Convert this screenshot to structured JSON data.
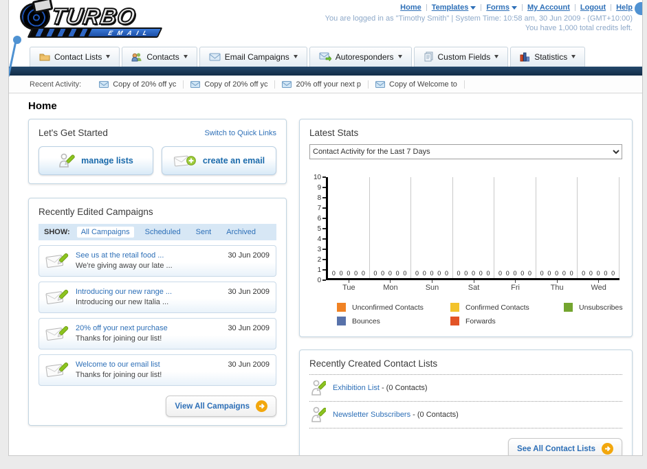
{
  "header": {
    "logo_title": "TURBO",
    "logo_subtitle": "EMAIL",
    "nav_links": [
      {
        "label": "Home",
        "dropdown": false
      },
      {
        "label": "Templates",
        "dropdown": true
      },
      {
        "label": "Forms",
        "dropdown": true
      },
      {
        "label": "My Account",
        "dropdown": false
      },
      {
        "label": "Logout",
        "dropdown": false
      },
      {
        "label": "Help",
        "dropdown": false
      }
    ],
    "login_info": "You are logged in as \"Timothy Smith\" | System Time: 10:58 am, 30 Jun 2009 - (GMT+10:00)",
    "credits_info": "You have 1,000 total credits left."
  },
  "nav_tabs": [
    {
      "label": "Contact Lists",
      "icon": "folder-icon"
    },
    {
      "label": "Contacts",
      "icon": "contacts-icon"
    },
    {
      "label": "Email Campaigns",
      "icon": "envelope-icon"
    },
    {
      "label": "Autoresponders",
      "icon": "envelope-arrow-icon"
    },
    {
      "label": "Custom Fields",
      "icon": "pages-icon"
    },
    {
      "label": "Statistics",
      "icon": "bar-chart-icon"
    }
  ],
  "recent_activity": {
    "label": "Recent Activity:",
    "items": [
      {
        "text": "Copy of 20% off yc"
      },
      {
        "text": "Copy of 20% off yc"
      },
      {
        "text": "20% off your next p"
      },
      {
        "text": "Copy of Welcome to"
      }
    ]
  },
  "page_title": "Home",
  "getting_started": {
    "heading": "Let's Get Started",
    "switch_link": "Switch to Quick Links",
    "manage_lists_label": "manage lists",
    "create_email_label": "create an email"
  },
  "campaigns": {
    "heading": "Recently Edited Campaigns",
    "show_label": "SHOW:",
    "filters": [
      {
        "label": "All Campaigns",
        "active": true
      },
      {
        "label": "Scheduled",
        "active": false
      },
      {
        "label": "Sent",
        "active": false
      },
      {
        "label": "Archived",
        "active": false
      }
    ],
    "items": [
      {
        "title": "See us at the retail food ...",
        "subtitle": "We're giving away our late ...",
        "date": "30 Jun 2009"
      },
      {
        "title": "Introducing our new range ...",
        "subtitle": "Introducing our new Italia ...",
        "date": "30 Jun 2009"
      },
      {
        "title": "20% off your next purchase",
        "subtitle": "Thanks for joining our list!",
        "date": "30 Jun 2009"
      },
      {
        "title": "Welcome to our email list",
        "subtitle": "Thanks for joining our list!",
        "date": "30 Jun 2009"
      }
    ],
    "view_all_label": "View All Campaigns"
  },
  "stats": {
    "heading": "Latest Stats",
    "dropdown_value": "Contact Activity for the Last 7 Days"
  },
  "chart_data": {
    "type": "bar",
    "title": "Contact Activity for the Last 7 Days",
    "categories": [
      "Tue",
      "Mon",
      "Sun",
      "Sat",
      "Fri",
      "Thu",
      "Wed"
    ],
    "series": [
      {
        "name": "Unconfirmed Contacts",
        "color": "#f08224",
        "values": [
          0,
          0,
          0,
          0,
          0,
          0,
          0
        ]
      },
      {
        "name": "Confirmed Contacts",
        "color": "#f3c32c",
        "values": [
          0,
          0,
          0,
          0,
          0,
          0,
          0
        ]
      },
      {
        "name": "Unsubscribes",
        "color": "#74a52f",
        "values": [
          0,
          0,
          0,
          0,
          0,
          0,
          0
        ]
      },
      {
        "name": "Bounces",
        "color": "#5872aa",
        "values": [
          0,
          0,
          0,
          0,
          0,
          0,
          0
        ]
      },
      {
        "name": "Forwards",
        "color": "#e25426",
        "values": [
          0,
          0,
          0,
          0,
          0,
          0,
          0
        ]
      }
    ],
    "ylim": [
      0,
      10
    ],
    "xlabel": "",
    "ylabel": "",
    "grid": "vertical",
    "legend_position": "bottom"
  },
  "contact_lists": {
    "heading": "Recently Created Contact Lists",
    "items": [
      {
        "name": "Exhibition List",
        "count_text": "- (0 Contacts)"
      },
      {
        "name": "Newsletter Subscribers",
        "count_text": "- (0 Contacts)"
      }
    ],
    "see_all_label": "See All Contact Lists"
  },
  "colors": {
    "accent_blue": "#2d6fb7",
    "navy_bar": "#17334f",
    "orange_button": "#f2a70d",
    "green_pencil": "#8cc41f"
  }
}
